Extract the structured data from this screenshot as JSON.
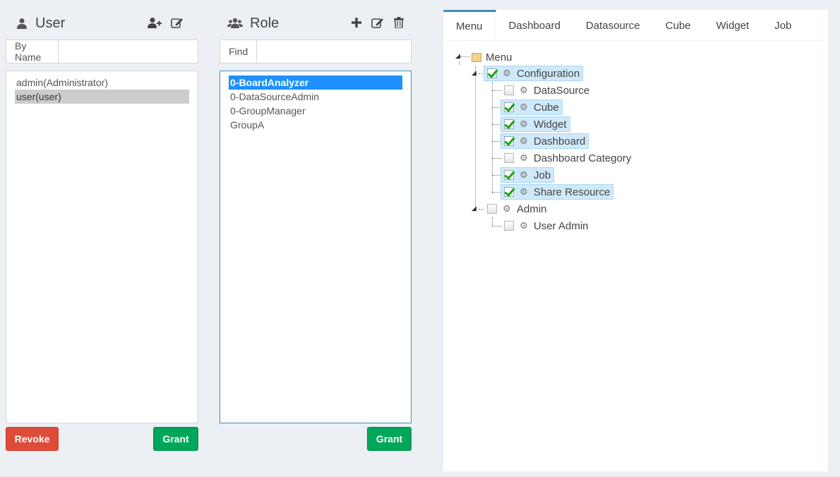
{
  "user_panel": {
    "title": "User",
    "search_addon": "By Name",
    "search_value": "",
    "items": [
      "admin(Administrator)",
      "user(user)"
    ],
    "revoke_label": "Revoke",
    "grant_label": "Grant"
  },
  "role_panel": {
    "title": "Role",
    "search_addon": "Find",
    "search_value": "",
    "items": [
      "0-BoardAnalyzer",
      "0-DataSourceAdmin",
      "0-GroupManager",
      "GroupA"
    ],
    "grant_label": "Grant"
  },
  "tabs": [
    "Menu",
    "Dashboard",
    "Datasource",
    "Cube",
    "Widget",
    "Job"
  ],
  "tree": {
    "root": "Menu",
    "configuration": "Configuration",
    "config_children": [
      "DataSource",
      "Cube",
      "Widget",
      "Dashboard",
      "Dashboard Category",
      "Job",
      "Share Resource"
    ],
    "config_checked": [
      false,
      true,
      true,
      true,
      false,
      true,
      true
    ],
    "admin": "Admin",
    "admin_children": [
      "User Admin"
    ]
  },
  "colors": {
    "accent": "#3c8dbc",
    "danger": "#dd4b39",
    "success": "#00a65a",
    "highlight": "#cfe9f9"
  }
}
